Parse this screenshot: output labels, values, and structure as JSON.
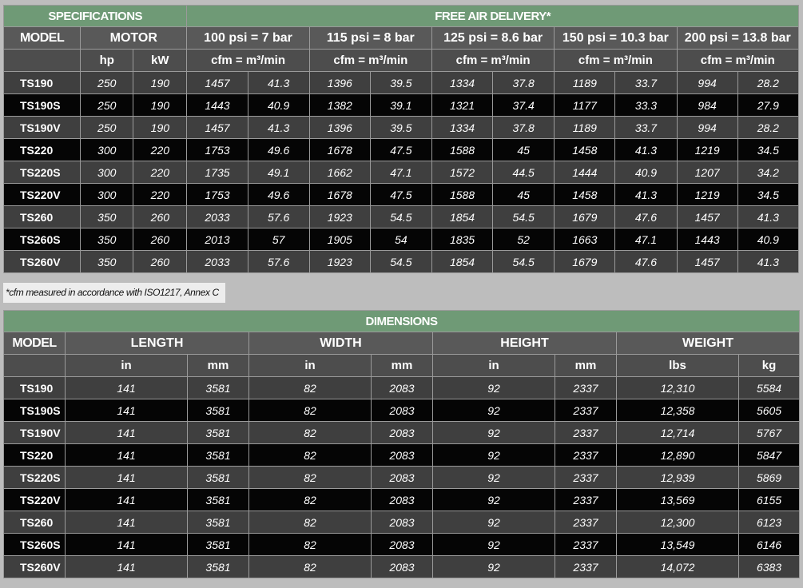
{
  "spec_table": {
    "group_headers": [
      "SPECIFICATIONS",
      "FREE AIR DELIVERY*"
    ],
    "model_header": "MODEL",
    "motor_header": "MOTOR",
    "pressure_headers": [
      "100 psi = 7 bar",
      "115 psi = 8 bar",
      "125 psi = 8.6 bar",
      "150 psi = 10.3 bar",
      "200 psi = 13.8 bar"
    ],
    "motor_units": [
      "hp",
      "kW"
    ],
    "flow_unit": "cfm = m³/min",
    "rows": [
      {
        "model": "TS190",
        "hp": "250",
        "kw": "190",
        "flow": [
          "1457",
          "41.3",
          "1396",
          "39.5",
          "1334",
          "37.8",
          "1189",
          "33.7",
          "994",
          "28.2"
        ]
      },
      {
        "model": "TS190S",
        "hp": "250",
        "kw": "190",
        "flow": [
          "1443",
          "40.9",
          "1382",
          "39.1",
          "1321",
          "37.4",
          "1177",
          "33.3",
          "984",
          "27.9"
        ]
      },
      {
        "model": "TS190V",
        "hp": "250",
        "kw": "190",
        "flow": [
          "1457",
          "41.3",
          "1396",
          "39.5",
          "1334",
          "37.8",
          "1189",
          "33.7",
          "994",
          "28.2"
        ]
      },
      {
        "model": "TS220",
        "hp": "300",
        "kw": "220",
        "flow": [
          "1753",
          "49.6",
          "1678",
          "47.5",
          "1588",
          "45",
          "1458",
          "41.3",
          "1219",
          "34.5"
        ]
      },
      {
        "model": "TS220S",
        "hp": "300",
        "kw": "220",
        "flow": [
          "1735",
          "49.1",
          "1662",
          "47.1",
          "1572",
          "44.5",
          "1444",
          "40.9",
          "1207",
          "34.2"
        ]
      },
      {
        "model": "TS220V",
        "hp": "300",
        "kw": "220",
        "flow": [
          "1753",
          "49.6",
          "1678",
          "47.5",
          "1588",
          "45",
          "1458",
          "41.3",
          "1219",
          "34.5"
        ]
      },
      {
        "model": "TS260",
        "hp": "350",
        "kw": "260",
        "flow": [
          "2033",
          "57.6",
          "1923",
          "54.5",
          "1854",
          "54.5",
          "1679",
          "47.6",
          "1457",
          "41.3"
        ]
      },
      {
        "model": "TS260S",
        "hp": "350",
        "kw": "260",
        "flow": [
          "2013",
          "57",
          "1905",
          "54",
          "1835",
          "52",
          "1663",
          "47.1",
          "1443",
          "40.9"
        ]
      },
      {
        "model": "TS260V",
        "hp": "350",
        "kw": "260",
        "flow": [
          "2033",
          "57.6",
          "1923",
          "54.5",
          "1854",
          "54.5",
          "1679",
          "47.6",
          "1457",
          "41.3"
        ]
      }
    ]
  },
  "footnote": "*cfm measured in accordance with ISO1217, Annex C",
  "dim_table": {
    "title": "DIMENSIONS",
    "model_header": "MODEL",
    "group_headers": [
      "LENGTH",
      "WIDTH",
      "HEIGHT",
      "WEIGHT"
    ],
    "unit_headers": [
      "in",
      "mm",
      "in",
      "mm",
      "in",
      "mm",
      "lbs",
      "kg"
    ],
    "rows": [
      {
        "model": "TS190",
        "values": [
          "141",
          "3581",
          "82",
          "2083",
          "92",
          "2337",
          "12,310",
          "5584"
        ]
      },
      {
        "model": "TS190S",
        "values": [
          "141",
          "3581",
          "82",
          "2083",
          "92",
          "2337",
          "12,358",
          "5605"
        ]
      },
      {
        "model": "TS190V",
        "values": [
          "141",
          "3581",
          "82",
          "2083",
          "92",
          "2337",
          "12,714",
          "5767"
        ]
      },
      {
        "model": "TS220",
        "values": [
          "141",
          "3581",
          "82",
          "2083",
          "92",
          "2337",
          "12,890",
          "5847"
        ]
      },
      {
        "model": "TS220S",
        "values": [
          "141",
          "3581",
          "82",
          "2083",
          "92",
          "2337",
          "12,939",
          "5869"
        ]
      },
      {
        "model": "TS220V",
        "values": [
          "141",
          "3581",
          "82",
          "2083",
          "92",
          "2337",
          "13,569",
          "6155"
        ]
      },
      {
        "model": "TS260",
        "values": [
          "141",
          "3581",
          "82",
          "2083",
          "92",
          "2337",
          "12,300",
          "6123"
        ]
      },
      {
        "model": "TS260S",
        "values": [
          "141",
          "3581",
          "82",
          "2083",
          "92",
          "2337",
          "13,549",
          "6146"
        ]
      },
      {
        "model": "TS260V",
        "values": [
          "141",
          "3581",
          "82",
          "2083",
          "92",
          "2337",
          "14,072",
          "6383"
        ]
      }
    ]
  },
  "colors": {
    "header_green": "#6f9a76",
    "row_light": "#3f3f3f",
    "row_dark": "#050505",
    "header_gray": "#595959"
  }
}
